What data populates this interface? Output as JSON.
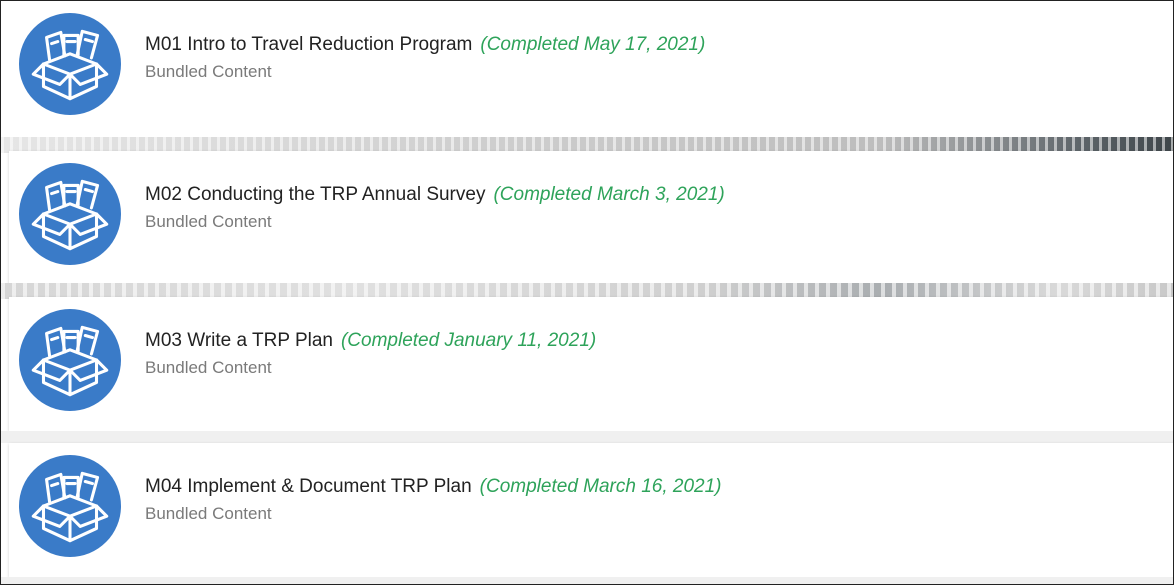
{
  "items": [
    {
      "title": "M01 Intro to Travel Reduction Program",
      "status": "(Completed May 17, 2021)",
      "subtitle": "Bundled Content",
      "icon": "bundled-content-box-icon"
    },
    {
      "title": "M02 Conducting the TRP Annual Survey",
      "status": "(Completed March 3, 2021)",
      "subtitle": "Bundled Content",
      "icon": "bundled-content-box-icon"
    },
    {
      "title": "M03 Write a TRP Plan",
      "status": "(Completed January 11, 2021)",
      "subtitle": "Bundled Content",
      "icon": "bundled-content-box-icon"
    },
    {
      "title": "M04 Implement & Document TRP Plan",
      "status": "(Completed March 16, 2021)",
      "subtitle": "Bundled Content",
      "icon": "bundled-content-box-icon"
    }
  ],
  "colors": {
    "icon_bg": "#3a7bc8",
    "status_green": "#2ea35a",
    "title": "#222222",
    "subtitle": "#7a7a7a"
  }
}
